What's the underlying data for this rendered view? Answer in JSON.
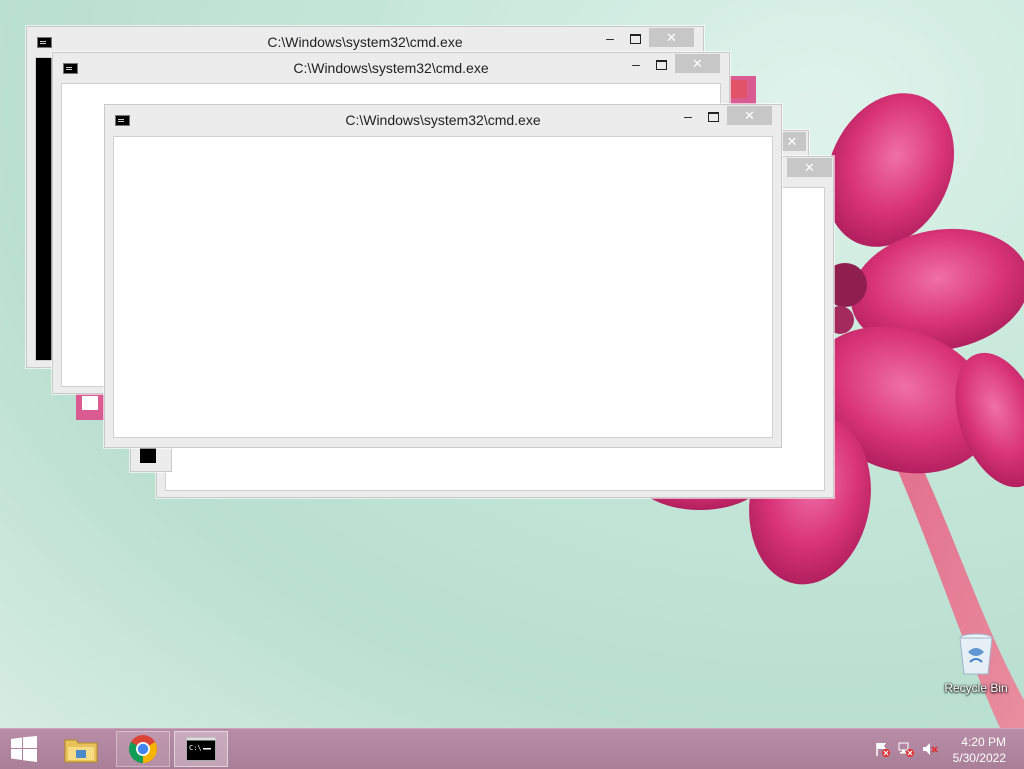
{
  "windows": [
    {
      "title": "C:\\Windows\\system32\\cmd.exe",
      "minimize": "–",
      "close": "✕",
      "icon": "cmd-icon"
    },
    {
      "title": "C:\\Windows\\system32\\cmd.exe",
      "minimize": "–",
      "close": "✕",
      "icon": "cmd-icon"
    },
    {
      "title": "C:\\Windows\\system32\\cmd.exe",
      "minimize": "–",
      "close": "✕",
      "icon": "cmd-icon"
    },
    {
      "title": "",
      "close": "✕"
    },
    {
      "title": "",
      "close": "✕"
    }
  ],
  "desktop": {
    "recycle_bin_label": "Recycle Bin"
  },
  "taskbar": {
    "time": "4:20 PM",
    "date": "5/30/2022",
    "pinned": [
      {
        "name": "file-explorer"
      },
      {
        "name": "chrome"
      },
      {
        "name": "command-prompt",
        "state": "active"
      }
    ]
  },
  "colors": {
    "taskbar": "#b88ca6",
    "close_button": "#c7c7c7",
    "flower": "#e0457f"
  }
}
